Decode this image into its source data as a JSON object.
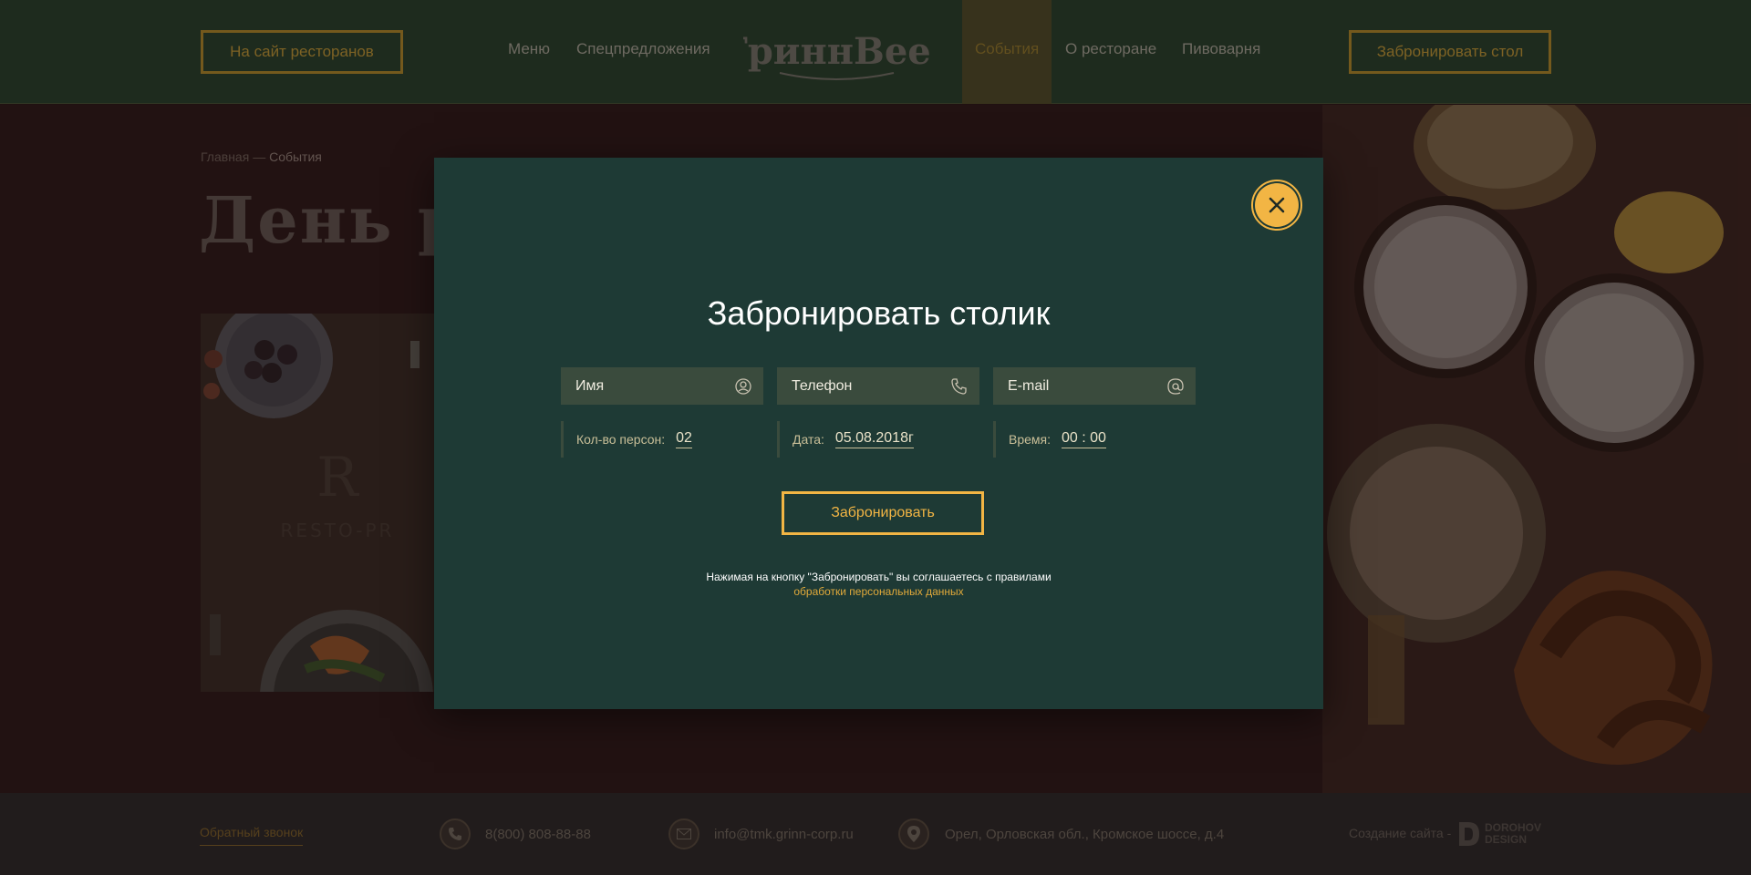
{
  "header": {
    "left_button": "На сайт ресторанов",
    "right_button": "Забронировать стол",
    "logo_text": "ГриннBeer",
    "nav": [
      "Меню",
      "Спецпредложения",
      "События",
      "О ресторане",
      "Пивоварня"
    ],
    "active_nav": "События"
  },
  "page": {
    "breadcrumb_home": "Главная",
    "breadcrumb_sep": "—",
    "breadcrumb_current": "События",
    "title_visible": "День рож",
    "card_logo_text": "RESTO-PR"
  },
  "modal": {
    "title": "Забронировать столик",
    "fields": [
      {
        "placeholder": "Имя",
        "icon": "user-icon"
      },
      {
        "placeholder": "Телефон",
        "icon": "phone-icon"
      },
      {
        "placeholder": "E-mail",
        "icon": "at-icon"
      }
    ],
    "persons_label": "Кол-во персон:",
    "persons_value": "02",
    "date_label": "Дата:",
    "date_value": "05.08.2018г",
    "time_label": "Время:",
    "time_value": "00 : 00",
    "submit_label": "Забронировать",
    "agree_text": "Нажимая на кнопку \"Забронировать\" вы соглашаетесь с правилами",
    "agree_link": "обработки персональных данных"
  },
  "footer": {
    "callback": "Обратный звонок",
    "phone": "8(800) 808-88-88",
    "email": "info@tmk.grinn-corp.ru",
    "address": "Орел, Орловская обл., Кромское шоссе, д.4",
    "credit": "Создание сайта -",
    "credit_logo_line1": "DOROHOV",
    "credit_logo_line2": "DESIGN"
  },
  "colors": {
    "accent": "#f2b544",
    "header_bg": "#27452f",
    "modal_bg": "#1e3a35"
  }
}
